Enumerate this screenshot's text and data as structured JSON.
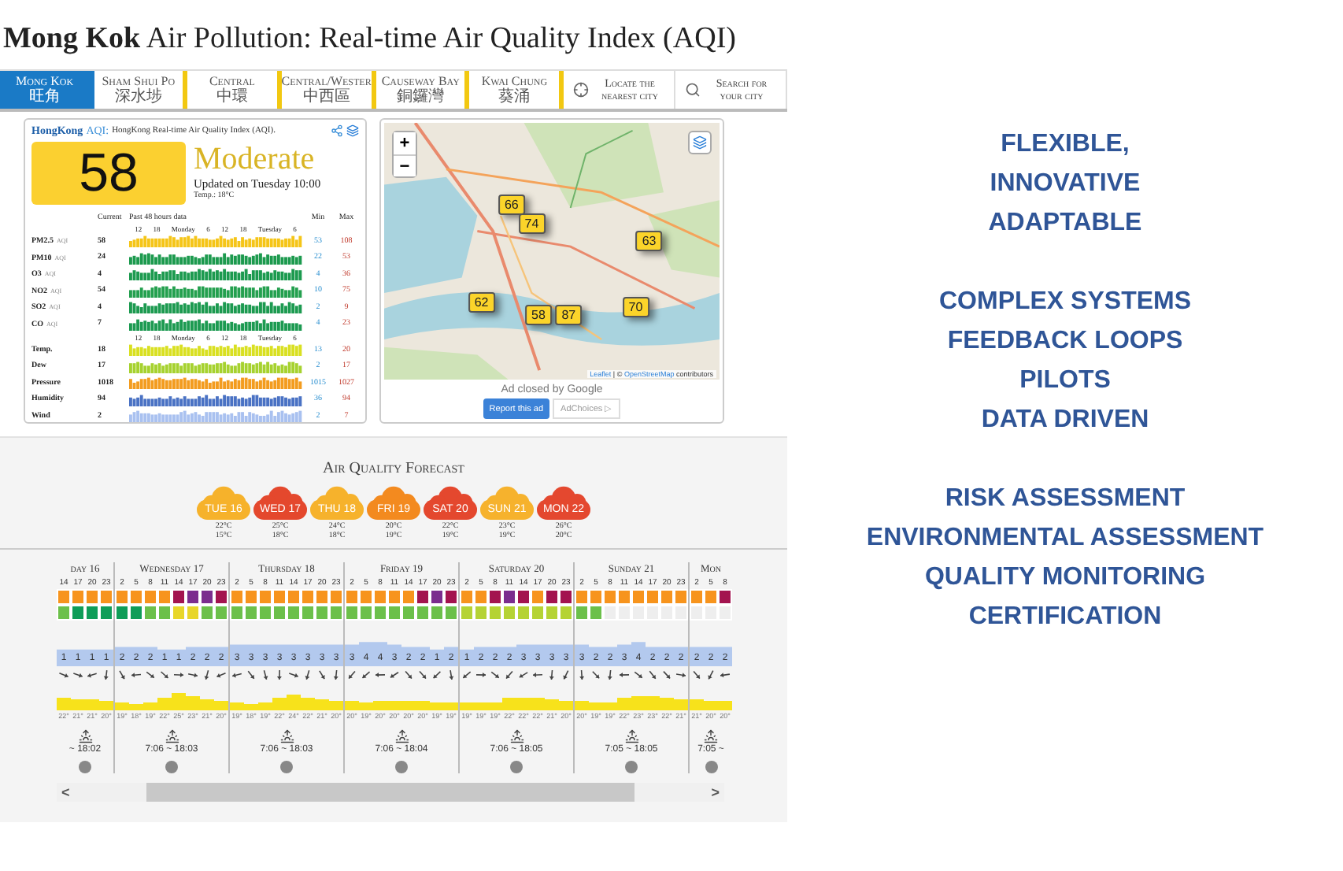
{
  "title": {
    "bold": "Mong Kok",
    "rest": "Air Pollution: Real-time Air Quality Index (AQI)"
  },
  "nav": {
    "cities": [
      {
        "name": "Mong Kok",
        "local": "旺角",
        "selected": true
      },
      {
        "name": "Sham Shui Po",
        "local": "深水埗",
        "selected": false
      },
      {
        "name": "Central",
        "local": "中環",
        "selected": false
      },
      {
        "name": "Central/Wester",
        "local": "中西區",
        "selected": false
      },
      {
        "name": "Causeway Bay",
        "local": "銅鑼灣",
        "selected": false
      },
      {
        "name": "Kwai Chung",
        "local": "葵涌",
        "selected": false
      }
    ],
    "actions": [
      {
        "kind": "locate",
        "label": "Locate the nearest city"
      },
      {
        "kind": "search",
        "label": "Search for your city"
      }
    ]
  },
  "aqi_card": {
    "brand": "HongKong",
    "brand_suffix": "AQI:",
    "subtitle": "HongKong Real-time Air Quality Index (AQI).",
    "value": "58",
    "level_text": "Moderate",
    "updated": "Updated on Tuesday 10:00",
    "temp": "Temp.: 18°C",
    "head": {
      "current": "Current",
      "past": "Past 48 hours data",
      "min": "Min",
      "max": "Max"
    },
    "rows": [
      {
        "kind": "axis",
        "labels": [
          "12",
          "18",
          "Monday",
          "6",
          "12",
          "18",
          "Tuesday",
          "6"
        ]
      },
      {
        "kind": "metric",
        "name": "PM2.5",
        "unit": "AQI",
        "current": "58",
        "min": "53",
        "max": "108",
        "color": "#f5c518"
      },
      {
        "kind": "metric",
        "name": "PM10",
        "unit": "AQI",
        "current": "24",
        "min": "22",
        "max": "53",
        "color": "#1c9a4e"
      },
      {
        "kind": "metric",
        "name": "O3",
        "unit": "AQI",
        "current": "4",
        "min": "4",
        "max": "36",
        "color": "#1c9a4f"
      },
      {
        "kind": "metric",
        "name": "NO2",
        "unit": "AQI",
        "current": "54",
        "min": "10",
        "max": "75",
        "color": "#24a04f"
      },
      {
        "kind": "metric",
        "name": "SO2",
        "unit": "AQI",
        "current": "4",
        "min": "2",
        "max": "9",
        "color": "#1c9a50"
      },
      {
        "kind": "metric",
        "name": "CO",
        "unit": "AQI",
        "current": "7",
        "min": "4",
        "max": "23",
        "color": "#1c9a51"
      },
      {
        "kind": "axis",
        "labels": [
          "12",
          "18",
          "Monday",
          "6",
          "12",
          "18",
          "Tuesday",
          "6"
        ]
      },
      {
        "kind": "metric",
        "name": "Temp.",
        "current": "18",
        "min": "13",
        "max": "20",
        "color": "#d9e021"
      },
      {
        "kind": "metric",
        "name": "Dew",
        "current": "17",
        "min": "2",
        "max": "17",
        "color": "#a6d22f"
      },
      {
        "kind": "metric",
        "name": "Pressure",
        "current": "1018",
        "min": "1015",
        "max": "1027",
        "color": "#f39c1f"
      },
      {
        "kind": "metric",
        "name": "Humidity",
        "current": "94",
        "min": "36",
        "max": "94",
        "color": "#4a72c4"
      },
      {
        "kind": "metric",
        "name": "Wind",
        "current": "2",
        "min": "2",
        "max": "7",
        "color": "#a9c1f0"
      }
    ]
  },
  "map": {
    "zoom_in": "+",
    "zoom_out": "−",
    "markers": [
      {
        "value": "66"
      },
      {
        "value": "74"
      },
      {
        "value": "63"
      },
      {
        "value": "62"
      },
      {
        "value": "58"
      },
      {
        "value": "87"
      },
      {
        "value": "70"
      }
    ],
    "attribution": {
      "link1": "Leaflet",
      "middle": "| ©",
      "link2": "OpenStreetMap",
      "tail": "contributors"
    },
    "ad_note": "Ad closed by Google",
    "report": "Report this ad",
    "adchoices": "AdChoices ▷"
  },
  "forecast": {
    "title": "Air Quality Forecast",
    "days": [
      {
        "label": "TUE 16",
        "high": "22°C",
        "low": "15°C",
        "color": "#f6b22b"
      },
      {
        "label": "WED 17",
        "high": "25°C",
        "low": "18°C",
        "color": "#e4482d"
      },
      {
        "label": "THU 18",
        "high": "24°C",
        "low": "18°C",
        "color": "#f6b22c"
      },
      {
        "label": "FRI 19",
        "high": "20°C",
        "low": "19°C",
        "color": "#f38a1f"
      },
      {
        "label": "SAT 20",
        "high": "22°C",
        "low": "19°C",
        "color": "#e4482e"
      },
      {
        "label": "SUN 21",
        "high": "23°C",
        "low": "19°C",
        "color": "#f6b22d"
      },
      {
        "label": "MON 22",
        "high": "26°C",
        "low": "20°C",
        "color": "#e4482f"
      }
    ]
  },
  "hourly": {
    "days": [
      {
        "name": "day 16",
        "hours": [
          "14",
          "17",
          "20",
          "23"
        ],
        "wind": [
          "1",
          "1",
          "1",
          "1"
        ],
        "temps": [
          "22°",
          "21°",
          "21°",
          "20°"
        ],
        "sun": "~ 18:02",
        "aqi": [
          {
            "color": "#f7941d"
          },
          {
            "color": "#f7941d"
          },
          {
            "color": "#f7941d"
          },
          {
            "color": "#f7941d"
          }
        ],
        "pollutant": [
          {
            "color": "#6cc04a"
          },
          {
            "color": "#0f9d58"
          },
          {
            "color": "#0f9d58"
          },
          {
            "color": "#0f9d58"
          }
        ]
      },
      {
        "name": "Wednesday 17",
        "hours": [
          "2",
          "5",
          "8",
          "11",
          "14",
          "17",
          "20",
          "23"
        ],
        "wind": [
          "2",
          "2",
          "2",
          "1",
          "1",
          "2",
          "2",
          "2"
        ],
        "temps": [
          "19°",
          "18°",
          "19°",
          "22°",
          "25°",
          "23°",
          "21°",
          "20°"
        ],
        "sun": "7:06 ~ 18:03",
        "aqi": [
          {
            "color": "#f7941d"
          },
          {
            "color": "#f7941d"
          },
          {
            "color": "#f7941d"
          },
          {
            "color": "#f7941d"
          },
          {
            "color": "#a3144f"
          },
          {
            "color": "#7b2d8e"
          },
          {
            "color": "#7b2d8e"
          },
          {
            "color": "#a3144f"
          }
        ],
        "pollutant": [
          {
            "color": "#0f9d58"
          },
          {
            "color": "#0f9d58"
          },
          {
            "color": "#6cc04a"
          },
          {
            "color": "#6cc04a"
          },
          {
            "color": "#e8d62a"
          },
          {
            "color": "#e8d62a"
          },
          {
            "color": "#6cc04a"
          },
          {
            "color": "#6cc04a"
          }
        ]
      },
      {
        "name": "Thursday 18",
        "hours": [
          "2",
          "5",
          "8",
          "11",
          "14",
          "17",
          "20",
          "23"
        ],
        "wind": [
          "3",
          "3",
          "3",
          "3",
          "3",
          "3",
          "3",
          "3"
        ],
        "temps": [
          "19°",
          "18°",
          "19°",
          "22°",
          "24°",
          "22°",
          "21°",
          "20°"
        ],
        "sun": "7:06 ~ 18:03",
        "aqi": [
          {
            "color": "#f7941d"
          },
          {
            "color": "#f7941d"
          },
          {
            "color": "#f7941d"
          },
          {
            "color": "#f7941d"
          },
          {
            "color": "#f7941d"
          },
          {
            "color": "#f7941d"
          },
          {
            "color": "#f7941d"
          },
          {
            "color": "#f7941d"
          }
        ],
        "pollutant": [
          {
            "color": "#6cc04a"
          },
          {
            "color": "#6cc04a"
          },
          {
            "color": "#6cc04a"
          },
          {
            "color": "#6cc04a"
          },
          {
            "color": "#6cc04a"
          },
          {
            "color": "#6cc04a"
          },
          {
            "color": "#6cc04a"
          },
          {
            "color": "#6cc04a"
          }
        ]
      },
      {
        "name": "Friday 19",
        "hours": [
          "2",
          "5",
          "8",
          "11",
          "14",
          "17",
          "20",
          "23"
        ],
        "wind": [
          "3",
          "4",
          "4",
          "3",
          "2",
          "2",
          "1",
          "2"
        ],
        "temps": [
          "20°",
          "19°",
          "20°",
          "20°",
          "20°",
          "20°",
          "19°",
          "19°"
        ],
        "sun": "7:06 ~ 18:04",
        "aqi": [
          {
            "color": "#f7941d"
          },
          {
            "color": "#f7941d"
          },
          {
            "color": "#f7941d"
          },
          {
            "color": "#f7941d"
          },
          {
            "color": "#f7941d"
          },
          {
            "color": "#a3144f"
          },
          {
            "color": "#7b2d8e"
          },
          {
            "color": "#a3144f"
          }
        ],
        "pollutant": [
          {
            "color": "#6cc04a"
          },
          {
            "color": "#6cc04a"
          },
          {
            "color": "#6cc04a"
          },
          {
            "color": "#6cc04a"
          },
          {
            "color": "#6cc04a"
          },
          {
            "color": "#6cc04a"
          },
          {
            "color": "#6cc04a"
          },
          {
            "color": "#6cc04a"
          }
        ]
      },
      {
        "name": "Saturday 20",
        "hours": [
          "2",
          "5",
          "8",
          "11",
          "14",
          "17",
          "20",
          "23"
        ],
        "wind": [
          "1",
          "2",
          "2",
          "2",
          "3",
          "3",
          "3",
          "3"
        ],
        "temps": [
          "19°",
          "19°",
          "19°",
          "22°",
          "22°",
          "22°",
          "21°",
          "20°"
        ],
        "sun": "7:06 ~ 18:05",
        "aqi": [
          {
            "color": "#f7941d"
          },
          {
            "color": "#f7941d"
          },
          {
            "color": "#a3144f"
          },
          {
            "color": "#7b2d8e"
          },
          {
            "color": "#a3144f"
          },
          {
            "color": "#f7941d"
          },
          {
            "color": "#a3144f"
          },
          {
            "color": "#a3144f"
          }
        ],
        "pollutant": [
          {
            "color": "#b5d334"
          },
          {
            "color": "#b5d334"
          },
          {
            "color": "#b5d334"
          },
          {
            "color": "#b5d334"
          },
          {
            "color": "#b5d334"
          },
          {
            "color": "#b5d334"
          },
          {
            "color": "#b5d334"
          },
          {
            "color": "#b5d334"
          }
        ]
      },
      {
        "name": "Sunday 21",
        "hours": [
          "2",
          "5",
          "8",
          "11",
          "14",
          "17",
          "20",
          "23"
        ],
        "wind": [
          "3",
          "2",
          "2",
          "3",
          "4",
          "2",
          "2",
          "2"
        ],
        "temps": [
          "20°",
          "19°",
          "19°",
          "22°",
          "23°",
          "23°",
          "22°",
          "21°"
        ],
        "sun": "7:05 ~ 18:05",
        "aqi": [
          {
            "color": "#f7941d"
          },
          {
            "color": "#f7941d"
          },
          {
            "color": "#f7941d"
          },
          {
            "color": "#f7941d"
          },
          {
            "color": "#f7941d"
          },
          {
            "color": "#f7941d"
          },
          {
            "color": "#f7941d"
          },
          {
            "color": "#f7941d"
          }
        ],
        "pollutant": [
          {
            "color": "#6cc04a"
          },
          {
            "color": "#6cc04a"
          },
          {
            "color": "#eeeeee"
          },
          {
            "color": "#eeeeee"
          },
          {
            "color": "#eeeeee"
          },
          {
            "color": "#eeeeee"
          },
          {
            "color": "#eeeeee"
          },
          {
            "color": "#eeeeee"
          }
        ]
      },
      {
        "name": "Mon",
        "hours": [
          "2",
          "5",
          "8"
        ],
        "wind": [
          "2",
          "2",
          "2"
        ],
        "temps": [
          "21°",
          "20°",
          "20°"
        ],
        "sun": "7:05 ~",
        "aqi": [
          {
            "color": "#f7941d"
          },
          {
            "color": "#f7941d"
          },
          {
            "color": "#a3144f"
          }
        ],
        "pollutant": [
          {
            "color": "#eeeeee"
          },
          {
            "color": "#eeeeee"
          },
          {
            "color": "#eeeeee"
          }
        ]
      }
    ],
    "scroll_left": "<",
    "scroll_right": ">"
  },
  "slide_text": {
    "groups": [
      [
        "FLEXIBLE,",
        "INNOVATIVE",
        "ADAPTABLE"
      ],
      [
        "COMPLEX SYSTEMS",
        "FEEDBACK LOOPS",
        "PILOTS",
        "DATA DRIVEN"
      ],
      [
        "RISK ASSESSMENT",
        "ENVIRONMENTAL ASSESSMENT",
        "QUALITY MONITORING",
        "CERTIFICATION"
      ]
    ]
  }
}
